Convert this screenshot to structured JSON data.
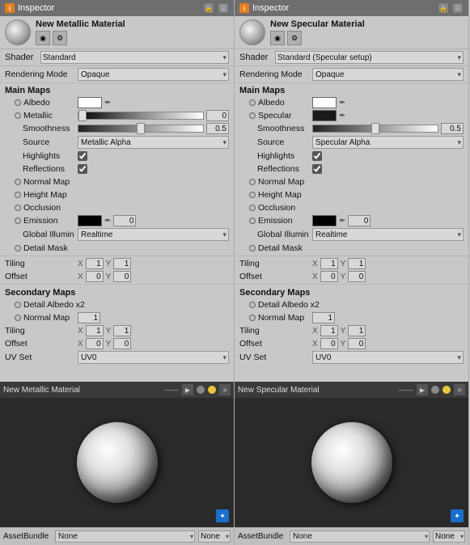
{
  "panels": [
    {
      "id": "metallic",
      "title": "Inspector",
      "material_name": "New Metallic Material",
      "shader_label": "Shader",
      "shader_value": "Standard",
      "rendering_mode_label": "Rendering Mode",
      "rendering_mode_value": "Opaque",
      "main_maps_label": "Main Maps",
      "albedo_label": "Albedo",
      "metallic_label": "Metallic",
      "metallic_value": "0",
      "smoothness_label": "Smoothness",
      "smoothness_value": "0.5",
      "source_label": "Source",
      "source_value": "Metallic Alpha",
      "highlights_label": "Highlights",
      "reflections_label": "Reflections",
      "normalmap_label": "Normal Map",
      "heightmap_label": "Height Map",
      "occlusion_label": "Occlusion",
      "emission_label": "Emission",
      "emission_value": "0",
      "global_illum_label": "Global Illumin",
      "global_illum_value": "Realtime",
      "detail_mask_label": "Detail Mask",
      "tiling_label": "Tiling",
      "tiling_x": "1",
      "tiling_y": "1",
      "offset_label": "Offset",
      "offset_x": "0",
      "offset_y": "0",
      "secondary_maps_label": "Secondary Maps",
      "detail_albedo_label": "Detail Albedo x2",
      "sec_normalmap_label": "Normal Map",
      "sec_normalmap_value": "1",
      "sec_tiling_x": "1",
      "sec_tiling_y": "1",
      "sec_offset_x": "0",
      "sec_offset_y": "0",
      "uv_set_label": "UV Set",
      "uv_set_value": "UV0",
      "preview_name": "New Metallic Material",
      "asset_bundle_label": "AssetBundle",
      "asset_bundle_value": "None",
      "asset_bundle_extra": "None"
    },
    {
      "id": "specular",
      "title": "Inspector",
      "material_name": "New Specular Material",
      "shader_label": "Shader",
      "shader_value": "Standard (Specular setup)",
      "rendering_mode_label": "Rendering Mode",
      "rendering_mode_value": "Opaque",
      "main_maps_label": "Main Maps",
      "albedo_label": "Albedo",
      "specular_label": "Specular",
      "smoothness_label": "Smoothness",
      "smoothness_value": "0.5",
      "source_label": "Source",
      "source_value": "Specular Alpha",
      "highlights_label": "Highlights",
      "reflections_label": "Reflections",
      "normalmap_label": "Normal Map",
      "heightmap_label": "Height Map",
      "occlusion_label": "Occlusion",
      "emission_label": "Emission",
      "emission_value": "0",
      "global_illum_label": "Global Illumin",
      "global_illum_value": "Realtime",
      "detail_mask_label": "Detail Mask",
      "tiling_label": "Tiling",
      "tiling_x": "1",
      "tiling_y": "1",
      "offset_label": "Offset",
      "offset_x": "0",
      "offset_y": "0",
      "secondary_maps_label": "Secondary Maps",
      "detail_albedo_label": "Detail Albedo x2",
      "sec_normalmap_label": "Normal Map",
      "sec_normalmap_value": "1",
      "sec_tiling_x": "1",
      "sec_tiling_y": "1",
      "sec_offset_x": "0",
      "sec_offset_y": "0",
      "uv_set_label": "UV Set",
      "uv_set_value": "UV0",
      "preview_name": "New Specular Material",
      "asset_bundle_label": "AssetBundle",
      "asset_bundle_value": "None",
      "asset_bundle_extra": "None"
    }
  ],
  "icons": {
    "lock": "🔒",
    "settings": "⚙",
    "arrow": "▸",
    "play": "▶",
    "eyedropper": "✒"
  }
}
